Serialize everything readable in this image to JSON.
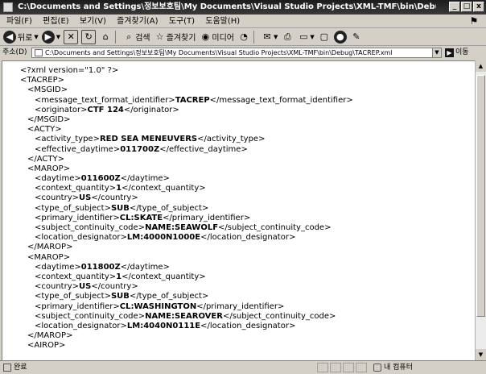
{
  "window": {
    "title": "C:\\Documents and Settings\\정보보호팀\\My Documents\\Visual Studio Projects\\XML-TMF\\bin\\Debug\\TACREP.xm",
    "minimize": "_",
    "maximize": "□",
    "close": "x"
  },
  "menu": {
    "items": [
      "파일(F)",
      "편집(E)",
      "보기(V)",
      "즐겨찾기(A)",
      "도구(T)",
      "도움말(H)"
    ]
  },
  "toolbar": {
    "back_label": "뒤로",
    "search_label": "검색",
    "favorites_label": "즐겨찾기",
    "media_label": "미디어"
  },
  "address": {
    "label": "주소(D)",
    "value": "C:\\Documents and Settings\\정보보호팀\\My Documents\\Visual Studio Projects\\XML-TMF\\bin\\Debug\\TACREP.xml",
    "go_label": "이동"
  },
  "document": {
    "lines": [
      {
        "indent": 0,
        "pre": "<?xml version=\"1.0\" ?>",
        "val": "",
        "post": ""
      },
      {
        "indent": 0,
        "pre": "<TACREP>",
        "val": "",
        "post": ""
      },
      {
        "indent": 1,
        "pre": "<MSGID>",
        "val": "",
        "post": ""
      },
      {
        "indent": 2,
        "pre": "<message_text_format_identifier>",
        "val": "TACREP",
        "post": "</message_text_format_identifier>"
      },
      {
        "indent": 2,
        "pre": "<originator>",
        "val": "CTF 124",
        "post": "</originator>"
      },
      {
        "indent": 1,
        "pre": "</MSGID>",
        "val": "",
        "post": ""
      },
      {
        "indent": 1,
        "pre": "<ACTY>",
        "val": "",
        "post": ""
      },
      {
        "indent": 2,
        "pre": "<activity_type>",
        "val": "RED SEA MENEUVERS",
        "post": "</activity_type>"
      },
      {
        "indent": 2,
        "pre": "<effective_daytime>",
        "val": "011700Z",
        "post": "</effective_daytime>"
      },
      {
        "indent": 1,
        "pre": "</ACTY>",
        "val": "",
        "post": ""
      },
      {
        "indent": 1,
        "pre": "<MAROP>",
        "val": "",
        "post": ""
      },
      {
        "indent": 2,
        "pre": "<daytime>",
        "val": "011600Z",
        "post": "</daytime>"
      },
      {
        "indent": 2,
        "pre": "<context_quantity>",
        "val": "1",
        "post": "</context_quantity>"
      },
      {
        "indent": 2,
        "pre": "<country>",
        "val": "US",
        "post": "</country>"
      },
      {
        "indent": 2,
        "pre": "<type_of_subject>",
        "val": "SUB",
        "post": "</type_of_subject>"
      },
      {
        "indent": 2,
        "pre": "<primary_identifier>",
        "val": "CL:SKATE",
        "post": "</primary_identifier>"
      },
      {
        "indent": 2,
        "pre": "<subject_continuity_code>",
        "val": "NAME:SEAWOLF",
        "post": "</subject_continuity_code>"
      },
      {
        "indent": 2,
        "pre": "<location_designator>",
        "val": "LM:4000N1000E",
        "post": "</location_designator>"
      },
      {
        "indent": 1,
        "pre": "</MAROP>",
        "val": "",
        "post": ""
      },
      {
        "indent": 1,
        "pre": "<MAROP>",
        "val": "",
        "post": ""
      },
      {
        "indent": 2,
        "pre": "<daytime>",
        "val": "011800Z",
        "post": "</daytime>"
      },
      {
        "indent": 2,
        "pre": "<context_quantity>",
        "val": "1",
        "post": "</context_quantity>"
      },
      {
        "indent": 2,
        "pre": "<country>",
        "val": "US",
        "post": "</country>"
      },
      {
        "indent": 2,
        "pre": "<type_of_subject>",
        "val": "SUB",
        "post": "</type_of_subject>"
      },
      {
        "indent": 2,
        "pre": "<primary_identifier>",
        "val": "CL:WASHINGTON",
        "post": "</primary_identifier>"
      },
      {
        "indent": 2,
        "pre": "<subject_continuity_code>",
        "val": "NAME:SEAROVER",
        "post": "</subject_continuity_code>"
      },
      {
        "indent": 2,
        "pre": "<location_designator>",
        "val": "LM:4040N0111E",
        "post": "</location_designator>"
      },
      {
        "indent": 1,
        "pre": "</MAROP>",
        "val": "",
        "post": ""
      },
      {
        "indent": 1,
        "pre": "<AIROP>",
        "val": "",
        "post": ""
      }
    ]
  },
  "status": {
    "text": "완료",
    "zone": "내 컴퓨터"
  }
}
